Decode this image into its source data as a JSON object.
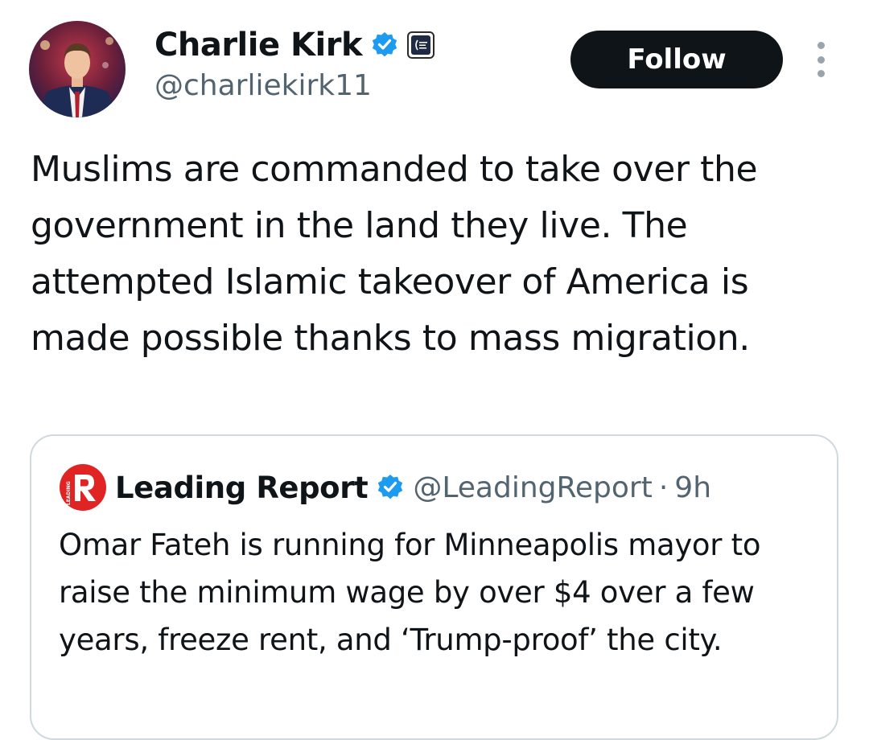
{
  "author": {
    "display_name": "Charlie Kirk",
    "handle": "@charliekirk11",
    "verified_badge_icon": "verified-badge-icon",
    "affiliate_badge_icon": "organization-affiliate-badge-icon"
  },
  "actions": {
    "follow_label": "Follow",
    "more_icon": "more-options-icon"
  },
  "tweet": {
    "text": "Muslims are commanded to take over the government in the land they live. The attempted Islamic takeover of America is made possible thanks to mass migration."
  },
  "quoted_tweet": {
    "display_name": "Leading Report",
    "handle": "@LeadingReport",
    "separator": "·",
    "time": "9h",
    "text": "Omar Fateh is running for Minneapolis mayor to raise the minimum wage by over $4 over a few years, freeze rent, and ‘Trump-proof’ the city.",
    "logo_icon": "leading-report-logo-icon"
  },
  "colors": {
    "verified_blue": "#1d9bf0",
    "follow_button_bg": "#0f1419",
    "secondary_text": "#536471",
    "leading_report_red": "#e02424"
  }
}
